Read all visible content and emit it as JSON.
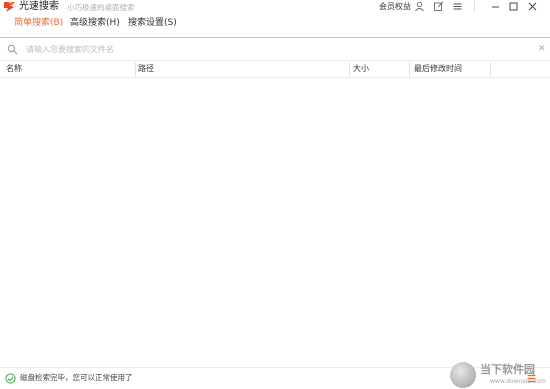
{
  "app": {
    "title": "光速搜索",
    "subtitle": "小巧极速的桌面搜索",
    "member_label": "会员权益"
  },
  "tabs": [
    {
      "label": "简单搜索(B)",
      "active": true
    },
    {
      "label": "高级搜索(H)",
      "active": false
    },
    {
      "label": "搜索设置(S)",
      "active": false
    }
  ],
  "search": {
    "placeholder": "请输入您要搜索的文件名",
    "value": ""
  },
  "table": {
    "columns": [
      "名称",
      "路径",
      "大小",
      "最后修改时间"
    ],
    "rows": []
  },
  "status": {
    "text": "磁盘检索完毕，您可以正常使用了"
  },
  "watermark": {
    "cn": "当下软件园",
    "en": "www.downxia.com"
  },
  "colors": {
    "accent": "#ee6b2f",
    "status_ok": "#46a84a"
  },
  "icons": [
    "app-logo-icon",
    "user-icon",
    "edit-icon",
    "hamburger-menu-icon",
    "minimize-icon",
    "maximize-icon",
    "close-icon",
    "search-icon",
    "clear-icon",
    "check-circle-icon",
    "list-menu-icon"
  ]
}
